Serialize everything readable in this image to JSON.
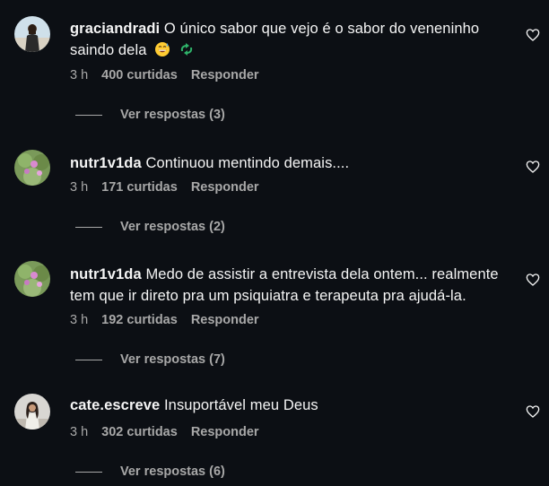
{
  "comments": [
    {
      "username": "graciandradi",
      "text": "O único sabor que vejo é o sabor do veneninho saindo dela",
      "emojis": [
        "grinning-face-with-sweat-emoji",
        "recycle-emoji"
      ],
      "time": "3 h",
      "likes": "400 curtidas",
      "reply_label": "Responder",
      "view_replies": "Ver respostas (3)"
    },
    {
      "username": "nutr1v1da",
      "text": "Continuou mentindo demais....",
      "time": "3 h",
      "likes": "171 curtidas",
      "reply_label": "Responder",
      "view_replies": "Ver respostas (2)"
    },
    {
      "username": "nutr1v1da",
      "text": "Medo de assistir a entrevista dela ontem... realmente tem que ir direto pra um psiquiatra e terapeuta pra ajudá-la.",
      "time": "3 h",
      "likes": "192 curtidas",
      "reply_label": "Responder",
      "view_replies": "Ver respostas (7)"
    },
    {
      "username": "cate.escreve",
      "text": "Insuportável meu Deus",
      "time": "3 h",
      "likes": "302 curtidas",
      "reply_label": "Responder",
      "view_replies": "Ver respostas (6)"
    }
  ],
  "colors": {
    "background": "#0c0f14",
    "primary_text": "#f5f5f5",
    "secondary_text": "#a8a8a8"
  }
}
